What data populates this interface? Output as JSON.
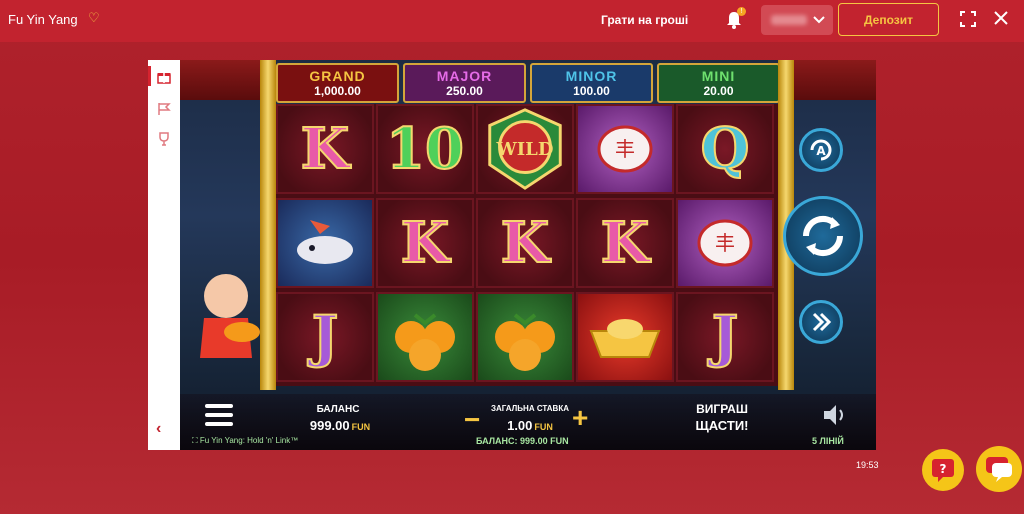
{
  "topbar": {
    "title": "Fu Yin Yang",
    "real_money_label": "Грати на гроші",
    "notifications_count": "!",
    "deposit_label": "Депозит"
  },
  "jackpots": [
    {
      "name": "GRAND",
      "value": "1,000.00",
      "color": "#f5c542",
      "bg": "#7a1010"
    },
    {
      "name": "MAJOR",
      "value": "250.00",
      "color": "#e56be6",
      "bg": "#5a1a5a"
    },
    {
      "name": "MINOR",
      "value": "100.00",
      "color": "#4fc3e8",
      "bg": "#1a3a6a"
    },
    {
      "name": "MINI",
      "value": "20.00",
      "color": "#6ee06e",
      "bg": "#1a5a2a"
    }
  ],
  "reels": {
    "wild_label": "WILD",
    "letters": {
      "K": "K",
      "ten": "10",
      "Q": "Q",
      "J": "J"
    }
  },
  "controls": {
    "balance_label": "БАЛАНС",
    "balance_value": "999.00",
    "currency": "FUN",
    "total_bet_label": "ЗАГАЛЬНА СТАВКА",
    "total_bet_value": "1.00",
    "win_label": "ВИГРАШ",
    "win_value": "ЩАСТИ!",
    "game_title": "Fu Yin Yang: Hold 'n' Link™",
    "sub_balance": "БАЛАНС: 999.00 FUN",
    "lines": "5 ЛІНІЙ"
  },
  "clock": "19:53",
  "help_glyph": "?"
}
